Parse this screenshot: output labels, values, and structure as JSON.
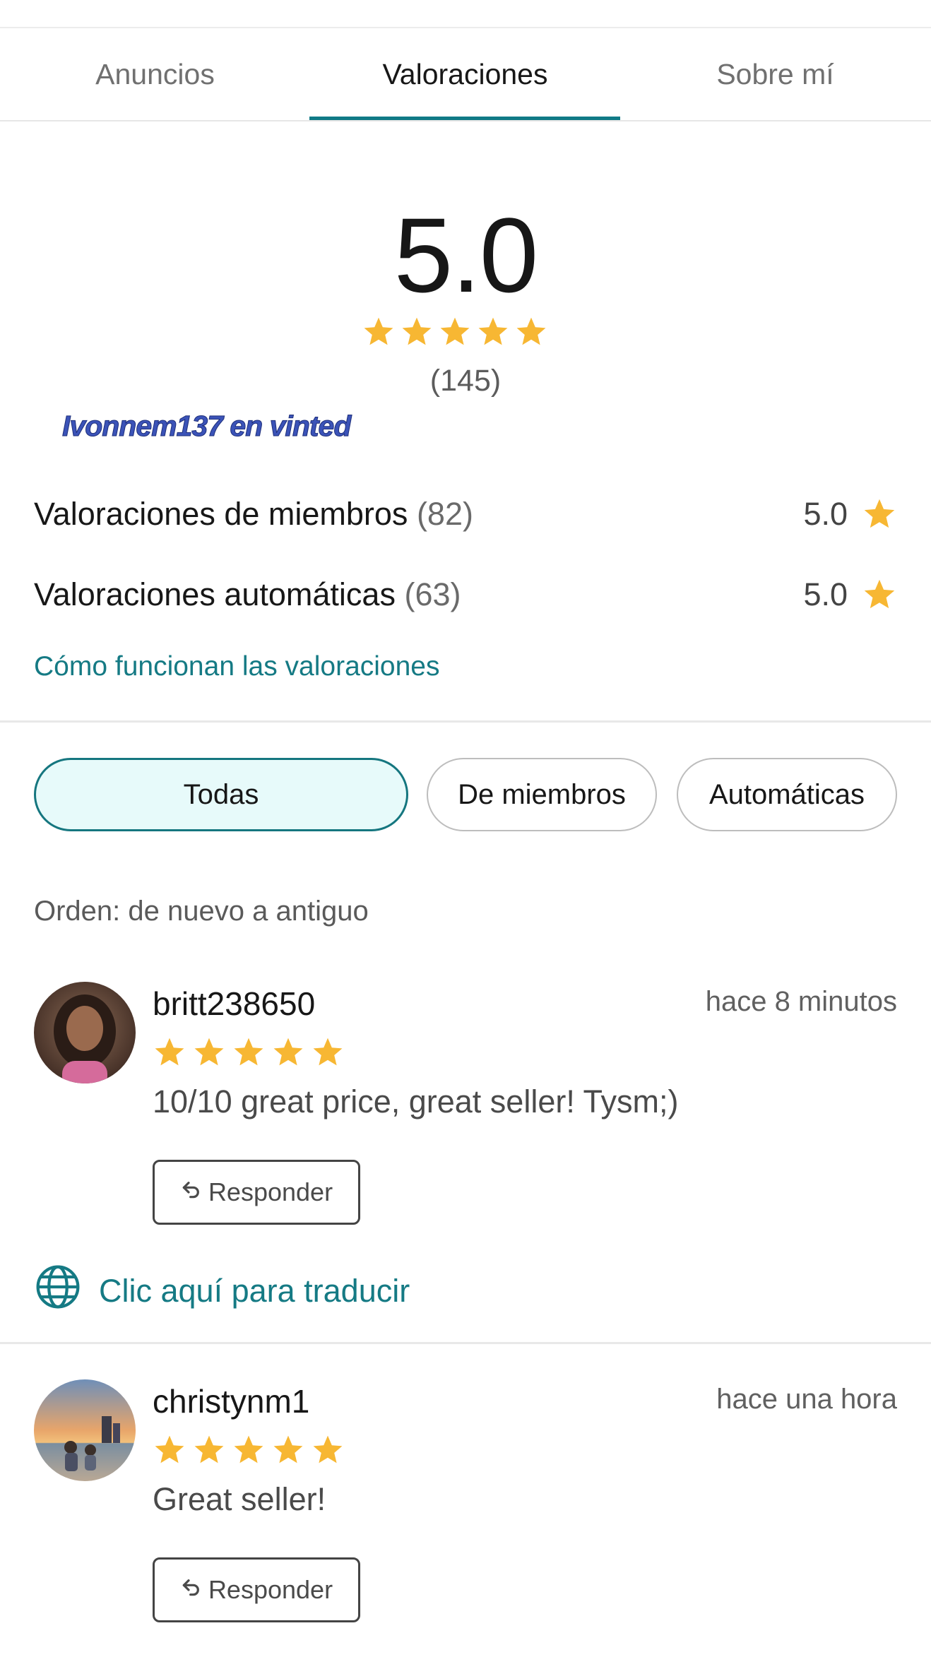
{
  "tabs": [
    {
      "label": "Anuncios",
      "active": false
    },
    {
      "label": "Valoraciones",
      "active": true
    },
    {
      "label": "Sobre mí",
      "active": false
    }
  ],
  "summary": {
    "score": "5.0",
    "stars": 5,
    "count": "(145)",
    "watermark": "Ivonnem137 en vinted"
  },
  "breakdown": [
    {
      "label": "Valoraciones de miembros",
      "count": "(82)",
      "score": "5.0"
    },
    {
      "label": "Valoraciones automáticas",
      "count": "(63)",
      "score": "5.0"
    }
  ],
  "how_link": "Cómo funcionan las valoraciones",
  "filters": [
    {
      "label": "Todas",
      "active": true
    },
    {
      "label": "De miembros",
      "active": false
    },
    {
      "label": "Automáticas",
      "active": false
    }
  ],
  "order": "Orden: de nuevo a antiguo",
  "reviews": [
    {
      "user": "britt238650",
      "time": "hace 8 minutos",
      "stars": 5,
      "text": "10/10 great price, great seller! Tysm;)",
      "reply": "Responder",
      "translate": "Clic aquí para traducir"
    },
    {
      "user": "christynm1",
      "time": "hace una hora",
      "stars": 5,
      "text": "Great seller!",
      "reply": "Responder"
    }
  ],
  "colors": {
    "accent": "#157a84",
    "star": "#f7b733",
    "active_chip_bg": "#e7fafa"
  },
  "icons": [
    "star-icon",
    "reply-arrow-icon",
    "globe-icon"
  ]
}
